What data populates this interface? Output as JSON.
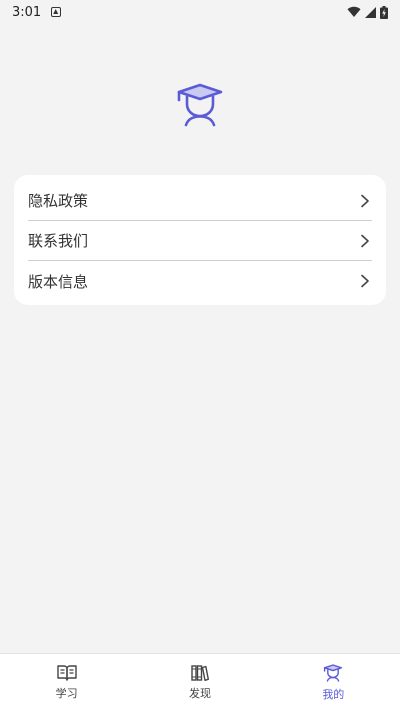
{
  "status_bar": {
    "time": "3:01",
    "notification_icon": "a-notification-icon",
    "wifi_icon": "wifi-icon",
    "signal_icon": "signal-icon",
    "battery_icon": "battery-charging-icon"
  },
  "profile": {
    "logo_icon": "graduate-icon"
  },
  "menu": {
    "items": [
      {
        "label": "隐私政策",
        "icon": "chevron-right-icon"
      },
      {
        "label": "联系我们",
        "icon": "chevron-right-icon"
      },
      {
        "label": "版本信息",
        "icon": "chevron-right-icon"
      }
    ]
  },
  "bottom_nav": {
    "items": [
      {
        "label": "学习",
        "icon": "book-icon",
        "active": false
      },
      {
        "label": "发现",
        "icon": "books-icon",
        "active": false
      },
      {
        "label": "我的",
        "icon": "graduate-icon",
        "active": true
      }
    ]
  },
  "colors": {
    "accent": "#5b5bd6",
    "background": "#f3f3f3",
    "card": "#ffffff"
  }
}
